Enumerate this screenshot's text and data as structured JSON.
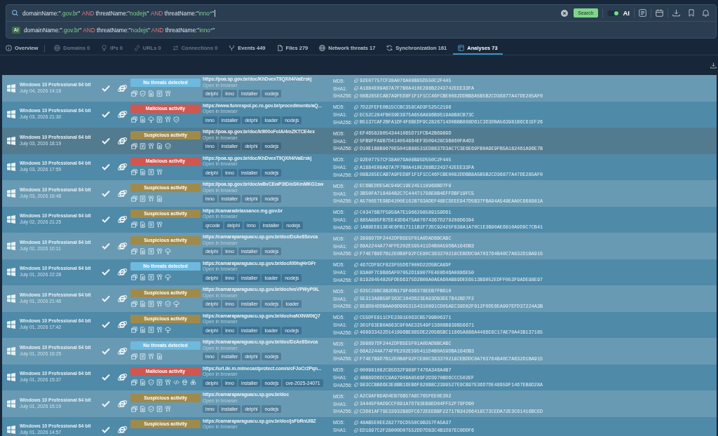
{
  "search": {
    "query": [
      {
        "kind": "plain",
        "text": "domainName:\""
      },
      {
        "kind": "value",
        "text": ".gov.br"
      },
      {
        "kind": "plain",
        "text": "\" "
      },
      {
        "kind": "operator",
        "text": "AND"
      },
      {
        "kind": "plain",
        "text": " threatName:\""
      },
      {
        "kind": "value",
        "text": "nodejs"
      },
      {
        "kind": "plain",
        "text": "\" "
      },
      {
        "kind": "operator",
        "text": "AND"
      },
      {
        "kind": "plain",
        "text": " threatName:\""
      },
      {
        "kind": "value",
        "text": "inno"
      },
      {
        "kind": "wildcard",
        "text": "*"
      },
      {
        "kind": "plain",
        "text": "\""
      }
    ],
    "focused": true,
    "button": "Search",
    "ai_toggle": {
      "label": "AI",
      "on": true
    }
  },
  "ai_suggestion": {
    "badge": "AI",
    "query": [
      {
        "kind": "plain",
        "text": "domainName:\""
      },
      {
        "kind": "value",
        "text": ".gov.br"
      },
      {
        "kind": "plain",
        "text": "\" "
      },
      {
        "kind": "operator",
        "text": "AND"
      },
      {
        "kind": "plain",
        "text": " threatName:\""
      },
      {
        "kind": "value",
        "text": "nodejs"
      },
      {
        "kind": "plain",
        "text": "\" "
      },
      {
        "kind": "operator",
        "text": "AND"
      },
      {
        "kind": "plain",
        "text": " threatName:\""
      },
      {
        "kind": "value",
        "text": "inno"
      },
      {
        "kind": "wildcard",
        "text": "*"
      },
      {
        "kind": "plain",
        "text": "\""
      }
    ]
  },
  "tabs": [
    {
      "label": "Overview",
      "kind": "info",
      "selected": false,
      "disabled": false
    },
    {
      "label": "Domains 0",
      "kind": "globe",
      "selected": false,
      "disabled": true
    },
    {
      "label": "IPs 0",
      "kind": "pin",
      "selected": false,
      "disabled": true
    },
    {
      "label": "URLs 0",
      "kind": "link",
      "selected": false,
      "disabled": true
    },
    {
      "label": "Connections 0",
      "kind": "connections",
      "selected": false,
      "disabled": true
    },
    {
      "label": "Events 449",
      "kind": "events",
      "selected": false,
      "disabled": false
    },
    {
      "label": "Files 279",
      "kind": "file",
      "selected": false,
      "disabled": false
    },
    {
      "label": "Network threats 17",
      "kind": "globe",
      "selected": false,
      "disabled": false
    },
    {
      "label": "Synchronization 161",
      "kind": "sync",
      "selected": false,
      "disabled": false
    },
    {
      "label": "Analyses 73",
      "kind": "analyses",
      "selected": true,
      "disabled": false
    }
  ],
  "rows": [
    {
      "os": "Windows 10 Professional 64 bit",
      "date": "July 04, 2026 14:18",
      "verdict": {
        "label": "No threats detected",
        "kind": "clean"
      },
      "indicators": [
        {
          "kind": "windows"
        },
        {
          "kind": "shield"
        },
        {
          "kind": "file"
        },
        {
          "kind": "grid"
        },
        {
          "kind": "keys"
        }
      ],
      "url": "https://poa.sp.gov.br/doc/KhDvexT9QX/t4iVaErskj",
      "link": "Open in browser",
      "tags": [
        "delphi",
        "inno",
        "installer",
        "nodejs"
      ],
      "hashes": [
        {
          "label": "MD5:",
          "value": "92E07757CF38A076A08B95D550C2F445"
        },
        {
          "label": "SHA1:",
          "value": "A1884E09A67A7F7B0A410E288B2243742EEE33FA"
        },
        {
          "label": "SHA256:",
          "value": "08B285ECAB7A9FED8F1F1F1CC46FCBE0082DDBB8A5B5B2CD36877A47DE285AF0"
        }
      ],
      "selected": false
    },
    {
      "os": "Windows 10 Professional 64 bit",
      "date": "July 03, 2026 21:30",
      "verdict": {
        "label": "Malicious activity",
        "kind": "malicious"
      },
      "indicators": [
        {
          "kind": "windows"
        },
        {
          "kind": "file"
        },
        {
          "kind": "network"
        },
        {
          "kind": "grid"
        },
        {
          "kind": "keys"
        },
        {
          "kind": "shield"
        }
      ],
      "url": "https://www.funrespol.pc.ro.gov.br/procedimento/aQ...",
      "link": "Open in browser",
      "tags": [
        "inno",
        "installer",
        "delphi",
        "loader",
        "nodejs"
      ],
      "hashes": [
        {
          "label": "MD5:",
          "value": "7D22FEFE0B15CCBC358CAD3F525C2196"
        },
        {
          "label": "SHA1:",
          "value": "EC52C284FB039E3975A656A886B9519A8B8CB73C"
        },
        {
          "label": "SHA256:",
          "value": "B5137CAF2BFA1DF4F6BEDF9C2826714D0BBB868D61C3D3DBA563981B6C61EF26"
        }
      ],
      "selected": false
    },
    {
      "os": "Windows 10 Professional 64 bit",
      "date": "July 03, 2026 18:19",
      "verdict": {
        "label": "Suspicious activity",
        "kind": "suspicious"
      },
      "indicators": [
        {
          "kind": "windows"
        },
        {
          "kind": "grid"
        },
        {
          "kind": "keys"
        },
        {
          "kind": "file"
        },
        {
          "kind": "shield"
        }
      ],
      "url": "https://poa.sp.gov.br/doc/k9l00oFolA/4mZKTCE4ex",
      "link": "Open in browser",
      "tags": [
        "inno",
        "installer",
        "delphi",
        "nodejs"
      ],
      "hashes": [
        {
          "label": "MD5:",
          "value": "EF4658280543441065D71FCB42B6989D"
        },
        {
          "label": "SHA1:",
          "value": "5FB9FFA9B7D414054864EF3509428C9B860FA4D3"
        },
        {
          "label": "SHA256:",
          "value": "D10E1B8B9670E5041B88531ED8837D3AC7C3E6E69FB0A9E9FB5A182461A96E7B"
        }
      ],
      "selected": true
    },
    {
      "os": "Windows 10 Professional 64 bit",
      "date": "July 03, 2026 17:59",
      "verdict": {
        "label": "Malicious activity",
        "kind": "malicious"
      },
      "indicators": [
        {
          "kind": "windows"
        },
        {
          "kind": "file"
        },
        {
          "kind": "grid"
        },
        {
          "kind": "keys"
        }
      ],
      "url": "https://poa.sp.gov.br/doc/KhDvexT9QX/t4iVaErskj",
      "link": "Open in browser",
      "tags": [
        "delphi",
        "inno",
        "installer",
        "nodejs"
      ],
      "hashes": [
        {
          "label": "MD5:",
          "value": "92E07757CF38A076A08B95D550C2F445"
        },
        {
          "label": "SHA1:",
          "value": "A1884E09A67A7F7B0A410E288B2243742EEE33FA"
        },
        {
          "label": "SHA256:",
          "value": "08B285ECAB7A9FED8F1F1F1CC46FCBE0082DDBB8A5B5B2CD36877A47DE285AF0"
        }
      ],
      "selected": false
    },
    {
      "os": "Windows 10 Professional 64 bit",
      "date": "July 03, 2026 16:48",
      "verdict": {
        "label": "Suspicious activity",
        "kind": "suspicious"
      },
      "indicators": [
        {
          "kind": "windows"
        },
        {
          "kind": "grid"
        },
        {
          "kind": "keys"
        },
        {
          "kind": "file"
        }
      ],
      "url": "https://poa.sp.gov.br/doc/wBvCEwP3tD/oSKmMKG1sw",
      "link": "Open in browser",
      "tags": [
        "inno",
        "installer",
        "delphi",
        "nodejs"
      ],
      "hashes": [
        {
          "label": "MD5:",
          "value": "EC6BEDDE5AC949C19E245118968BD7F9"
        },
        {
          "label": "SHA1:",
          "value": "3B50FA718484B2C7C44471798E8B4EFFDBF19FC5"
        },
        {
          "label": "SHA256:",
          "value": "A5706E7E9BD4200E162B793ADEF48ECDEEE947D5B37FBA94A549EAA0C668981A"
        }
      ],
      "selected": false
    },
    {
      "os": "Windows 10 Professional 64 bit",
      "date": "July 02, 2026 21:25",
      "verdict": {
        "label": "Suspicious activity",
        "kind": "suspicious"
      },
      "indicators": [
        {
          "kind": "windows"
        },
        {
          "kind": "file"
        },
        {
          "kind": "grid"
        },
        {
          "kind": "keys"
        }
      ],
      "url": "https://camaradelassance.mg.gov.br",
      "link": "Open in browser",
      "tags": [
        "qrcode",
        "delphi",
        "inno",
        "installer",
        "nodejs"
      ],
      "hashes": [
        {
          "label": "MD5:",
          "value": "C43476B7F5958A7E1966298589159D61"
        },
        {
          "label": "SHA1:",
          "value": "885A885FB7EE43D6475A07074367D279208D6394"
        },
        {
          "label": "SHA256:",
          "value": "1AB9EE813E4E6FB17111B1F72EC92425F838A1A70C1E3B90AE6810A9D9C7CB41"
        }
      ],
      "selected": false
    },
    {
      "os": "Windows 10 Professional 64 bit",
      "date": "July 02, 2026 10:11",
      "verdict": {
        "label": "Suspicious activity",
        "kind": "suspicious"
      },
      "indicators": [
        {
          "kind": "windows"
        },
        {
          "kind": "file"
        },
        {
          "kind": "grid"
        },
        {
          "kind": "keys"
        },
        {
          "kind": "network"
        }
      ],
      "url": "https://camaraparaguacu.sp.gov.br/doc/DzAe8Sxvca",
      "link": "Open in browser",
      "tags": [
        "delphi",
        "inno",
        "installer",
        "nodejs"
      ],
      "hashes": [
        {
          "label": "MD5:",
          "value": "399897DF2442DFB5E5F01A0DAD8BCABC"
        },
        {
          "label": "SHA1:",
          "value": "68A2244A774FFE202E595411D4B0A59DBA164DB3"
        },
        {
          "label": "SHA256:",
          "value": "F74E7B9D7B12E0B8F92FCE80C383370218CEBDDC0A703764B40C7A632D1BA915"
        }
      ],
      "selected": false
    },
    {
      "os": "Windows 10 Professional 64 bit",
      "date": "July 01, 2026 22:28",
      "verdict": {
        "label": "No threats detected",
        "kind": "clean"
      },
      "indicators": [
        {
          "kind": "windows"
        },
        {
          "kind": "file"
        },
        {
          "kind": "grid"
        },
        {
          "kind": "keys"
        },
        {
          "kind": "network"
        }
      ],
      "url": "https://camaraparaguacu.sp.gov.br/doc/l00hqHrGFr",
      "link": "Open in browser",
      "tags": [
        "delphi",
        "inno",
        "installer",
        "loader",
        "nodejs"
      ],
      "hashes": [
        {
          "label": "MD5:",
          "value": "467CDF9CF823F55D67000D22D5BCA89F"
        },
        {
          "label": "SHA1:",
          "value": "83A0F7C9B86AF07052D19807FE4E0D46A0886E50"
        },
        {
          "label": "SHA256:",
          "value": "81928454825FDE66375D2B08A0AEA60AB89DEE6513B6052EDFF053F9ADE98E97"
        }
      ],
      "selected": false
    },
    {
      "os": "Windows 10 Professional 64 bit",
      "date": "July 01, 2026 21:46",
      "verdict": {
        "label": "Suspicious activity",
        "kind": "suspicious"
      },
      "indicators": [
        {
          "kind": "windows"
        },
        {
          "kind": "file"
        },
        {
          "kind": "grid"
        },
        {
          "kind": "keys"
        },
        {
          "kind": "shield"
        },
        {
          "kind": "network"
        }
      ],
      "url": "https://camaraparaguacu.sp.gov.br/doc/wsVPWyP0iL",
      "link": "Open in browser",
      "tags": [
        "delphi",
        "inno",
        "installer",
        "nodejs",
        "loader"
      ],
      "hashes": [
        {
          "label": "MD5:",
          "value": "635C28BC8B2DB179F466378EEB7FB610"
        },
        {
          "label": "SHA1:",
          "value": "5E313A9B58F363C104D623EA93DB3EE7B42BD7F2"
        },
        {
          "label": "SHA256:",
          "value": "958D84DDBAA06D9953154310891CD05AEC39D82F912F0DE6EA997EFD37224A3B"
        }
      ],
      "selected": false
    },
    {
      "os": "Windows 10 Professional 64 bit",
      "date": "July 01, 2026 17:42",
      "verdict": {
        "label": "Suspicious activity",
        "kind": "suspicious"
      },
      "indicators": [
        {
          "kind": "windows"
        },
        {
          "kind": "file"
        },
        {
          "kind": "grid"
        },
        {
          "kind": "keys"
        },
        {
          "kind": "network"
        }
      ],
      "url": "https://camaraparaguacu.sp.gov.br/doc/naNXNW0tQ7",
      "link": "Open in browser",
      "tags": [
        "delphi",
        "inno",
        "installer",
        "loader",
        "nodejs"
      ],
      "hashes": [
        {
          "label": "MD5:",
          "value": "C55DFE911CFE2391E063CB5799B06371"
        },
        {
          "label": "SHA1:",
          "value": "301F63EB0A663C9F0AE33549F13608B839B56671"
        },
        {
          "label": "SHA256:",
          "value": "468933422D141996BE885DE2205B5BC11865A888A4466E8C17AE70A43B137185"
        }
      ],
      "selected": false
    },
    {
      "os": "Windows 10 Professional 64 bit",
      "date": "July 01, 2026 16:25",
      "verdict": {
        "label": "No threats detected",
        "kind": "clean"
      },
      "indicators": [
        {
          "kind": "windows"
        },
        {
          "kind": "grid"
        },
        {
          "kind": "keys"
        },
        {
          "kind": "file"
        }
      ],
      "url": "https://camaraparaguacu.sp.gov.br/doc/DzAe8Sxvca",
      "link": "Open in browser",
      "tags": [
        "inno",
        "installer",
        "delphi",
        "nodejs"
      ],
      "hashes": [
        {
          "label": "MD5:",
          "value": "399897DF2442DFB5E5F01A0DAD8BCABC"
        },
        {
          "label": "SHA1:",
          "value": "68A2244A774FFE202E595411D4B0A59DBA164DB3"
        },
        {
          "label": "SHA256:",
          "value": "F74E7B9D7B12E0B8F92FCE80C383370218CEBDDC0A703764B40C7A632D1BA915"
        }
      ],
      "selected": false
    },
    {
      "os": "Windows 10 Professional 64 bit",
      "date": "July 01, 2026 15:37",
      "verdict": {
        "label": "Malicious activity",
        "kind": "malicious"
      },
      "indicators": [
        {
          "kind": "windows"
        },
        {
          "kind": "file"
        },
        {
          "kind": "shield"
        },
        {
          "kind": "grid"
        },
        {
          "kind": "keys"
        },
        {
          "kind": "code"
        },
        {
          "kind": "skull"
        },
        {
          "kind": "biohazard"
        }
      ],
      "url": "https://url.de.m.mimecastprotect.com/s/cFJoCr2Pqn...",
      "link": "Open in browser",
      "tags": [
        "delphi",
        "inno",
        "installer",
        "nodejs",
        "cve-2025-24071"
      ],
      "hashes": [
        {
          "label": "MD5:",
          "value": "000981082C85D32F989F7476A346A4B7"
        },
        {
          "label": "SHA1:",
          "value": "4BB89D6DCC8A97909A8569F2D3970BD6CCC502EF"
        },
        {
          "label": "SHA256:",
          "value": "983CCBB66E3E8BB16EB6F828B8C2399527E9CB97E36D7DE48959F1467EB8D28A"
        }
      ],
      "selected": false
    },
    {
      "os": "Windows 10 Professional 64 bit",
      "date": "July 01, 2026 15:19",
      "verdict": {
        "label": "Suspicious activity",
        "kind": "suspicious"
      },
      "indicators": [
        {
          "kind": "windows"
        },
        {
          "kind": "file"
        },
        {
          "kind": "shield"
        },
        {
          "kind": "grid"
        },
        {
          "kind": "keys"
        }
      ],
      "url": "https://camaraparaguacu.sp.gov.br/doc",
      "link": "Open in browser",
      "tags": [
        "inno",
        "installer",
        "delphi",
        "nodejs"
      ],
      "hashes": [
        {
          "label": "MD5:",
          "value": "A2C9AFBDAD4EB76B57A8C765FEE0E302"
        },
        {
          "label": "SHA1:",
          "value": "34445F0AD9CCF891A7D783EB8ED04FF52F79FD60"
        },
        {
          "label": "SHA256:",
          "value": "C3681AF79E33932B8DFC672EEEBBF22717B34266418C73CEDA72E3C61416BCED"
        }
      ],
      "selected": false
    },
    {
      "os": "Windows 10 Professional 64 bit",
      "date": "July 01, 2026 14:57",
      "verdict": {
        "label": "Suspicious activity",
        "kind": "suspicious"
      },
      "url": "https://camaraparaguacu.sp.gov.br/doc/jsFbRnUI8Z",
      "link": "Open in browser",
      "hashes": [
        {
          "label": "MD5:",
          "value": "48AB5E0EE282776CD550C9B357FA5A37"
        },
        {
          "label": "SHA1:",
          "value": "ED1897C2F28000D07552DD7D83C4B1D97EC0DDF6"
        }
      ],
      "selected": false
    }
  ]
}
